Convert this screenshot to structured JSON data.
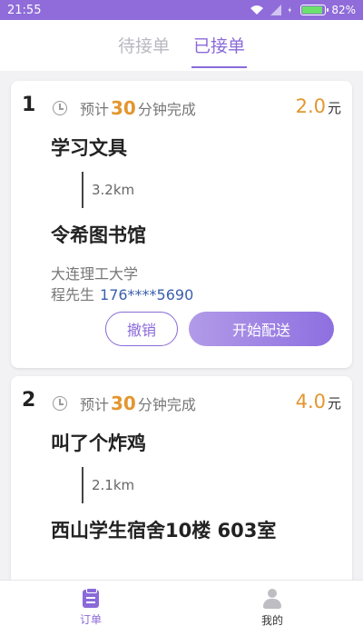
{
  "status": {
    "time": "21:55",
    "battery": "82%",
    "battery_level": 0.82
  },
  "tabs": [
    {
      "label": "待接单"
    },
    {
      "label": "已接单"
    }
  ],
  "orders": [
    {
      "index": "1",
      "eta_prefix": "预计",
      "eta_minutes": "30",
      "eta_suffix": "分钟完成",
      "price": "2.0",
      "currency": "元",
      "item": "学习文具",
      "distance": "3.2km",
      "destination": "令希图书馆",
      "school": "大连理工大学",
      "contact_name": "程先生",
      "phone": "176****5690",
      "cancel_label": "撤销",
      "start_label": "开始配送"
    },
    {
      "index": "2",
      "eta_prefix": "预计",
      "eta_minutes": "30",
      "eta_suffix": "分钟完成",
      "price": "4.0",
      "currency": "元",
      "item": "叫了个炸鸡",
      "distance": "2.1km",
      "destination": "西山学生宿舍10楼 603室"
    }
  ],
  "nav": [
    {
      "label": "订单",
      "icon": "order-icon"
    },
    {
      "label": "我的",
      "icon": "profile-icon"
    }
  ],
  "colors": {
    "accent": "#8a6ad9",
    "price": "#e3962f",
    "phone": "#3a5fad"
  }
}
